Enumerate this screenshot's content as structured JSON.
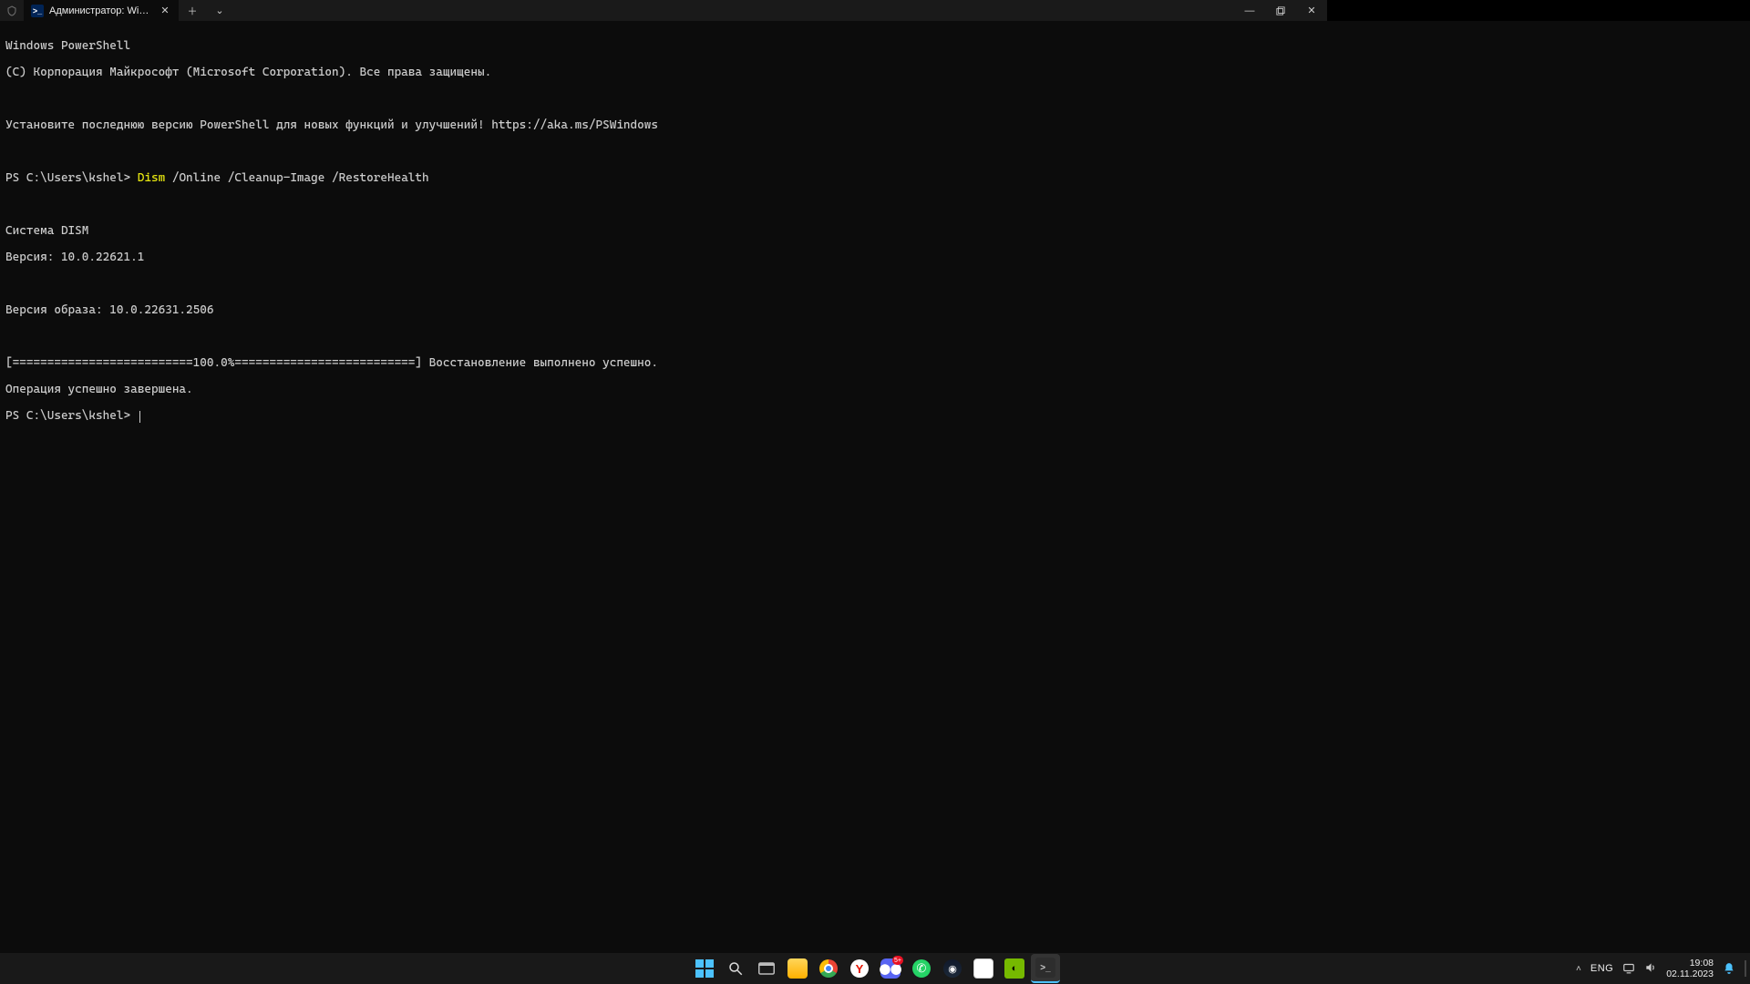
{
  "titlebar": {
    "tab_title": "Администратор: Windows Pc",
    "close_glyph": "✕",
    "new_tab_glyph": "＋",
    "dropdown_glyph": "⌄",
    "min_glyph": "—",
    "max_glyph": "▢"
  },
  "terminal": {
    "header1": "Windows PowerShell",
    "header2": "(C) Корпорация Майкрософт (Microsoft Corporation). Все права защищены.",
    "install_hint": "Установите последнюю версию PowerShell для новых функций и улучшений! https://aka.ms/PSWindows",
    "prompt": "PS C:\\Users\\kshel>",
    "command": "Dism",
    "command_args": " /Online /Cleanup-Image /RestoreHealth",
    "dism_title": "Cистема DISM",
    "dism_version": "Версия: 10.0.22621.1",
    "image_version": "Версия образа: 10.0.22631.2506",
    "progress": "[==========================100.0%==========================] Восстановление выполнено успешно.",
    "done": "Операция успешно завершена.",
    "prompt2": "PS C:\\Users\\kshel>"
  },
  "taskbar": {
    "lang": "ENG",
    "time": "19:08",
    "date": "02.11.2023",
    "discord_badge": "5+"
  }
}
